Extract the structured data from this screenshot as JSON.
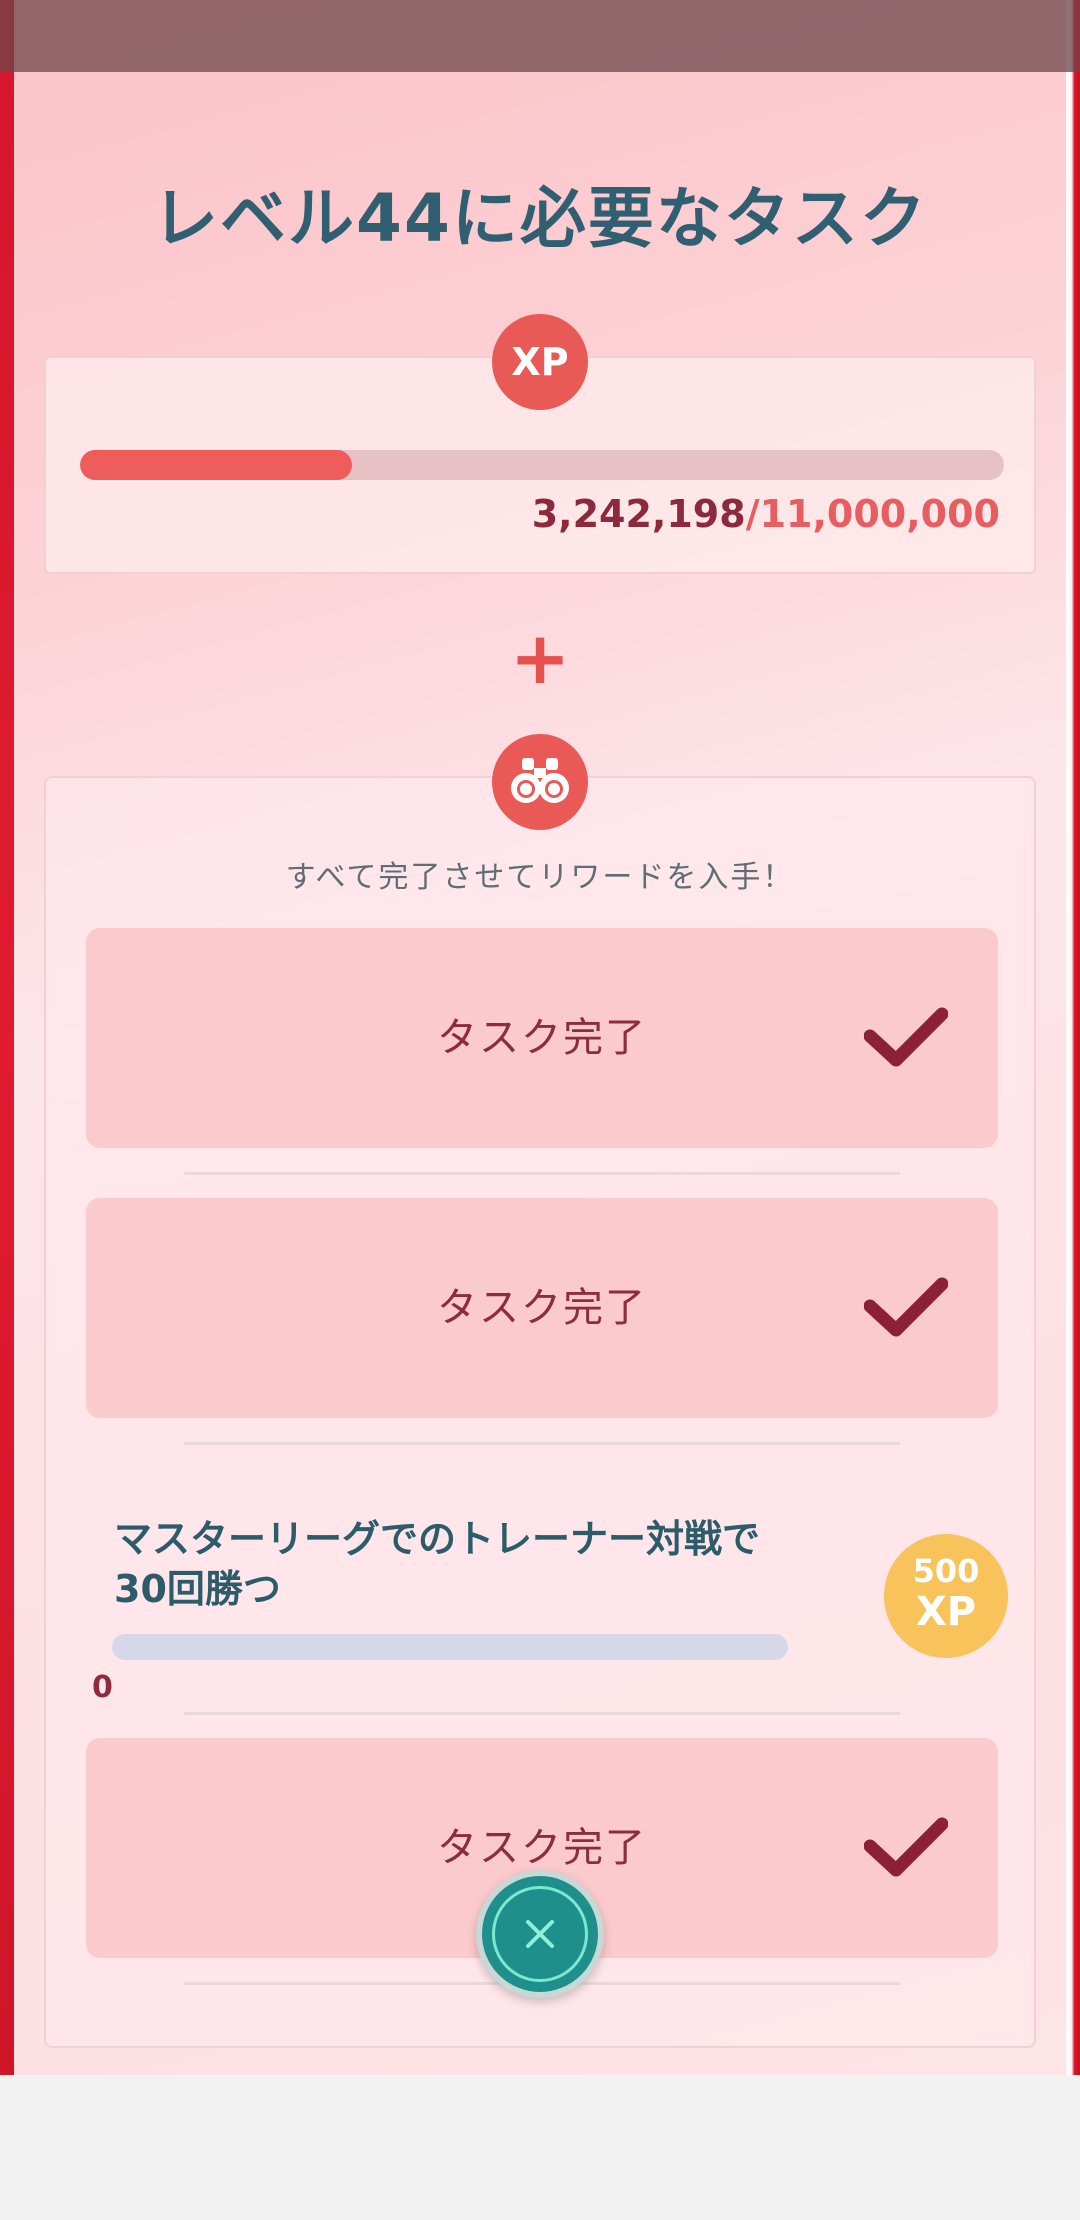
{
  "header": {
    "title": "レベル44に必要なタスク"
  },
  "xp": {
    "badge_label": "XP",
    "current": "3,242,198",
    "separator": "/",
    "goal": "11,000,000",
    "progress_fraction": 0.2947
  },
  "connector": {
    "plus_label": "+"
  },
  "tasks": {
    "subtitle": "すべて完了させてリワードを入手！",
    "items": [
      {
        "label": "タスク完了",
        "status": "done"
      },
      {
        "label": "タスク完了",
        "status": "done"
      },
      {
        "label": "マスターリーグでのトレーナー対戦で30回勝つ",
        "status": "open",
        "progress_count": "0",
        "reward_amount": "500",
        "reward_unit": "XP"
      },
      {
        "label": "タスク完了",
        "status": "done"
      }
    ]
  },
  "colors": {
    "accent_red": "#e95a57",
    "title_teal": "#2f5f70",
    "done_card": "#fbcacc",
    "reward_gold": "#f7c35a",
    "close_teal": "#1f8f8c"
  },
  "icons": {
    "xp_badge": "xp-icon",
    "binoculars": "binoculars-icon",
    "check": "check-icon",
    "close": "close-icon"
  }
}
